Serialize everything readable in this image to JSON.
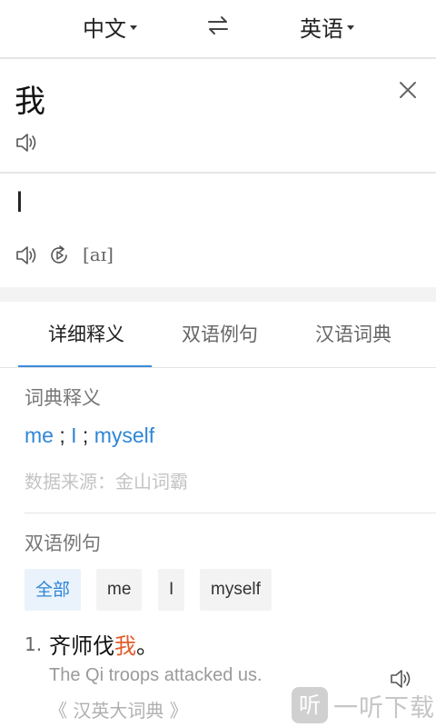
{
  "header": {
    "source_lang": "中文",
    "target_lang": "英语"
  },
  "input": {
    "word": "我"
  },
  "translation": {
    "word": "I",
    "phonetic": "[aɪ]"
  },
  "tabs": [
    {
      "label": "详细释义",
      "active": true
    },
    {
      "label": "双语例句",
      "active": false
    },
    {
      "label": "汉语词典",
      "active": false
    }
  ],
  "dictionary": {
    "title": "词典释义",
    "meanings": [
      "me",
      "I",
      "myself"
    ],
    "source": "数据来源：金山词霸"
  },
  "examples": {
    "title": "双语例句",
    "filters": [
      {
        "label": "全部",
        "active": true
      },
      {
        "label": "me",
        "active": false
      },
      {
        "label": "I",
        "active": false
      },
      {
        "label": "myself",
        "active": false
      }
    ],
    "items": [
      {
        "number": "1.",
        "cn_before": "齐师伐",
        "cn_highlight": "我",
        "cn_after": "。",
        "en": "The Qi troops attacked us.",
        "source": "《 汉英大词典 》"
      }
    ]
  },
  "watermark": {
    "logo_char": "听",
    "text": "一听下载"
  },
  "colors": {
    "accent": "#3a8bdc",
    "highlight": "#e25d2c"
  }
}
